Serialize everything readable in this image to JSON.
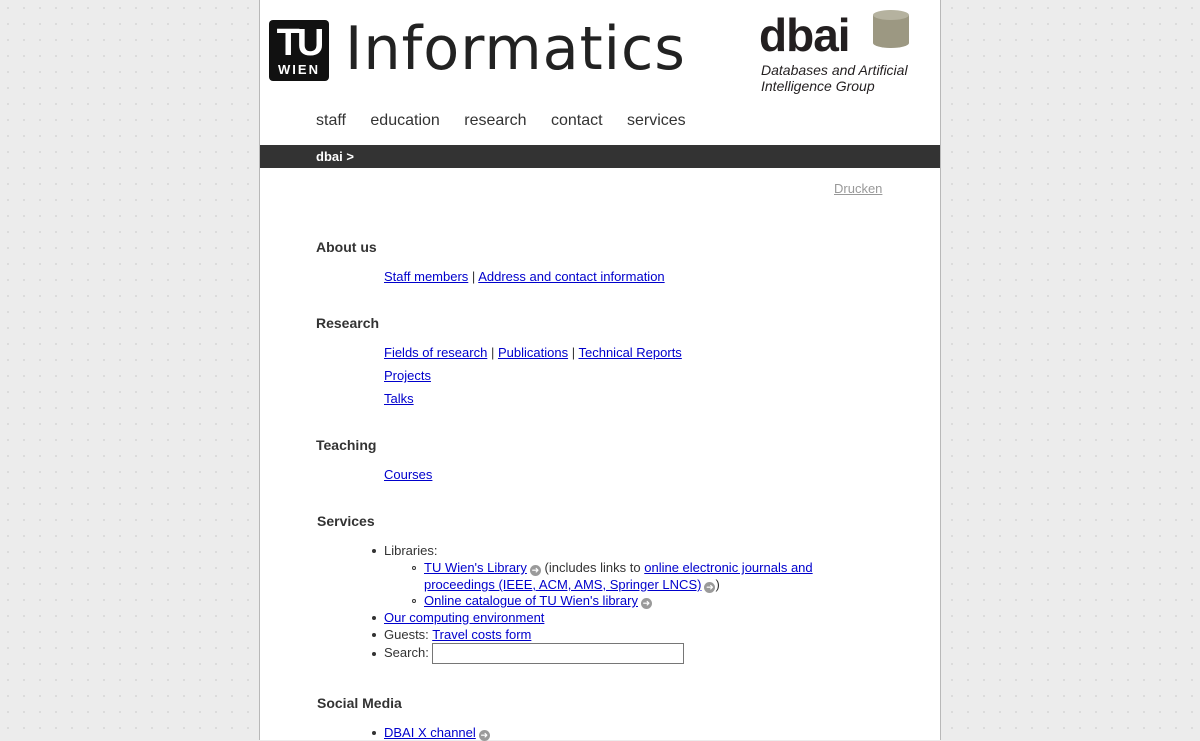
{
  "header": {
    "tu_logo": {
      "line1": "TU",
      "line2": "WIEN"
    },
    "title": "Informatics",
    "dbai_logo": {
      "word": "dbai",
      "line1": "Databases and Artificial",
      "line2": "Intelligence Group"
    }
  },
  "nav": [
    "staff",
    "education",
    "research",
    "contact",
    "services"
  ],
  "breadcrumb": "dbai >",
  "print_link": "Drucken",
  "sections": {
    "about": {
      "heading": "About us",
      "links": [
        "Staff members",
        "Address and contact information"
      ],
      "sep": "|"
    },
    "research": {
      "heading": "Research",
      "links": [
        "Fields of research",
        "Publications",
        "Technical Reports"
      ],
      "sep": "|",
      "projects": "Projects",
      "talks": "Talks"
    },
    "teaching": {
      "heading": "Teaching",
      "courses": "Courses"
    },
    "services": {
      "heading": "Services",
      "libraries_label": "Libraries:",
      "tu_library": "TU Wien's Library",
      "includes_text": "(includes links to",
      "journals_line1": "online electronic journals and",
      "journals_line2": "proceedings (IEEE, ACM, AMS, Springer LNCS)",
      "close_paren": ")",
      "catalogue": "Online catalogue of TU Wien's library",
      "computing": "Our computing environment",
      "guests_label": "Guests:",
      "travel": "Travel costs form",
      "search_label": "Search:",
      "search_value": ""
    },
    "social": {
      "heading": "Social Media",
      "x_channel": "DBAI X channel"
    }
  },
  "colors": {
    "link": "#0000cc",
    "breadcrumb_bg": "#333333",
    "cylinder": "#9c9882"
  },
  "icons": {
    "external": "circled-arrow-right-icon"
  }
}
